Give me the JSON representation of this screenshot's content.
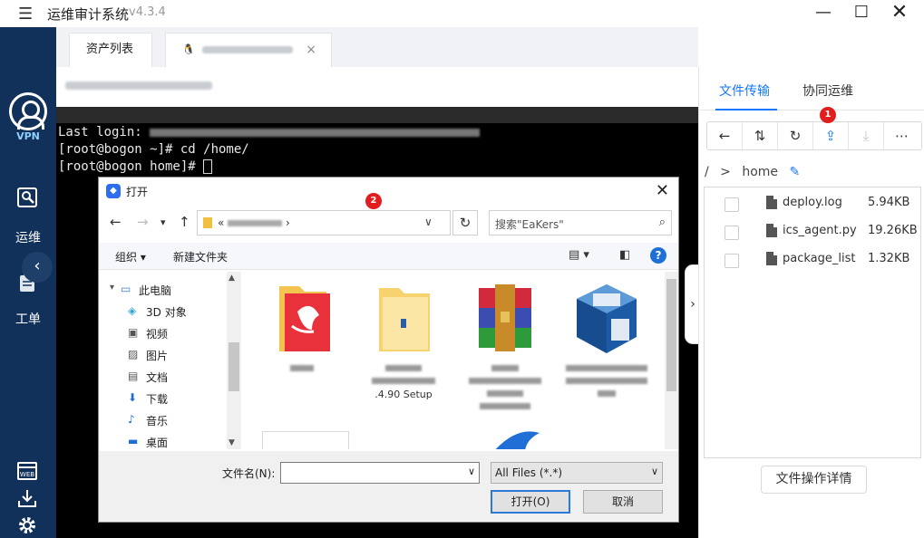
{
  "titlebar": {
    "title": "运维审计系统",
    "version": "v4.3.4"
  },
  "leftnav": {
    "vpn_label": "VPN",
    "ops_label": "运维",
    "ticket_label": "工单"
  },
  "tabs": {
    "assets_label": "资产列表",
    "session_close": "×"
  },
  "terminal": {
    "line1_prefix": "Last login: ",
    "line2": "[root@bogon ~]# cd /home/",
    "line3": "[root@bogon home]# "
  },
  "dialog": {
    "title": "打开",
    "address_prefix": "«",
    "search_placeholder": "搜索\"EaKers\"",
    "toolbar_organize": "组织 ▾",
    "toolbar_new_folder": "新建文件夹",
    "tree": [
      {
        "icon": "pc-icon",
        "label": "此电脑"
      },
      {
        "icon": "3d-objects-icon",
        "label": "3D 对象"
      },
      {
        "icon": "video-icon",
        "label": "视频"
      },
      {
        "icon": "pictures-icon",
        "label": "图片"
      },
      {
        "icon": "documents-icon",
        "label": "文档"
      },
      {
        "icon": "downloads-icon",
        "label": "下载"
      },
      {
        "icon": "music-icon",
        "label": "音乐"
      },
      {
        "icon": "desktop-icon",
        "label": "桌面"
      }
    ],
    "grid_partial_caption": ".4.90 Setup",
    "filename_label": "文件名(N):",
    "filename_value": "",
    "filetype_value": "All Files (*.*)",
    "open_label": "打开(O)",
    "cancel_label": "取消"
  },
  "badges": {
    "upload_badge": "1",
    "dialog_badge": "2"
  },
  "rpanel": {
    "tab_transfer": "文件传输",
    "tab_collab": "协同运维",
    "path_root": "/",
    "path_sep": ">",
    "path_current": "home",
    "files": [
      {
        "name": "deploy.log",
        "size": "5.94KB"
      },
      {
        "name": "ics_agent.py",
        "size": "19.26KB"
      },
      {
        "name": "package_list",
        "size": "1.32KB"
      }
    ],
    "detail_button": "文件操作详情"
  },
  "colors": {
    "nav_bg": "#11305a",
    "accent": "#1677ff",
    "badge_red": "#e21d1d",
    "terminal_bg": "#000000"
  }
}
